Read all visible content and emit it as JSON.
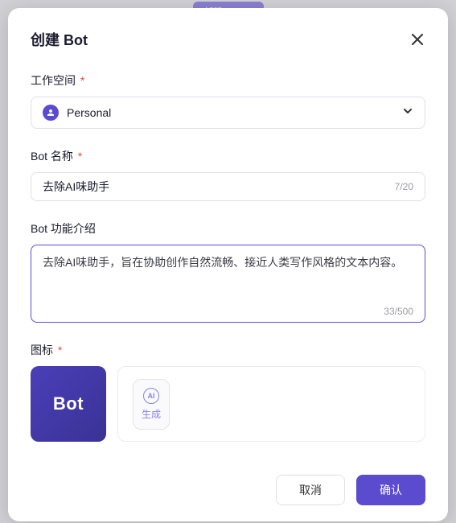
{
  "backdrop_pill": "新建 AI Bot",
  "modal": {
    "title": "创建 Bot"
  },
  "workspace": {
    "label": "工作空间",
    "value": "Personal"
  },
  "bot_name": {
    "label": "Bot 名称",
    "value": "去除AI味助手",
    "counter": "7/20"
  },
  "bot_desc": {
    "label": "Bot 功能介绍",
    "value": "去除AI味助手，旨在协助创作自然流畅、接近人类写作风格的文本内容。",
    "counter": "33/500"
  },
  "icon": {
    "label": "图标",
    "preview_text": "Bot",
    "ai_badge": "AI",
    "gen_label": "生成"
  },
  "footer": {
    "cancel": "取消",
    "confirm": "确认"
  }
}
